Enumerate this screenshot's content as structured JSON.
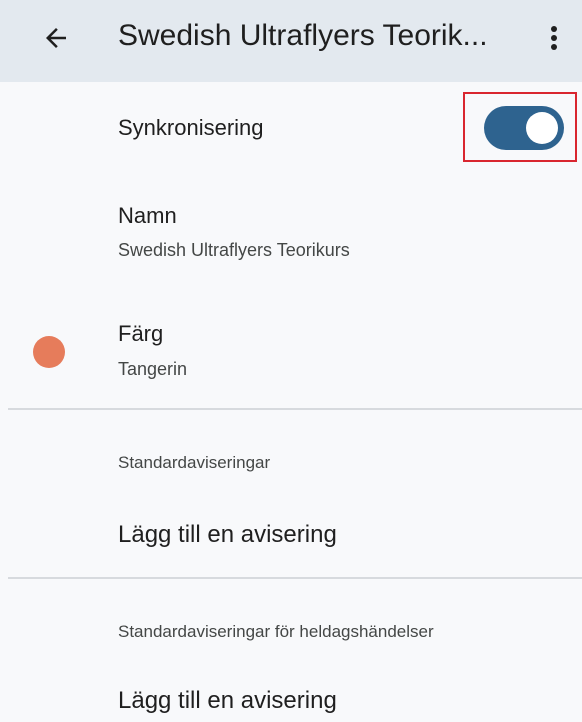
{
  "app_bar": {
    "title": "Swedish Ultraflyers Teorik...",
    "back_icon": "arrow-left-icon",
    "more_icon": "more-vertical-icon"
  },
  "sync": {
    "label": "Synkronisering",
    "enabled": true,
    "toggle_color": "#2e638f",
    "highlight_color": "#d9262f"
  },
  "name": {
    "label": "Namn",
    "value": "Swedish Ultraflyers Teorikurs"
  },
  "color": {
    "label": "Färg",
    "value": "Tangerin",
    "swatch": "#e67c5b"
  },
  "default_notifications": {
    "header": "Standardaviseringar",
    "add_label": "Lägg till en avisering"
  },
  "all_day_notifications": {
    "header": "Standardaviseringar för heldagshändelser",
    "add_label": "Lägg till en avisering"
  }
}
